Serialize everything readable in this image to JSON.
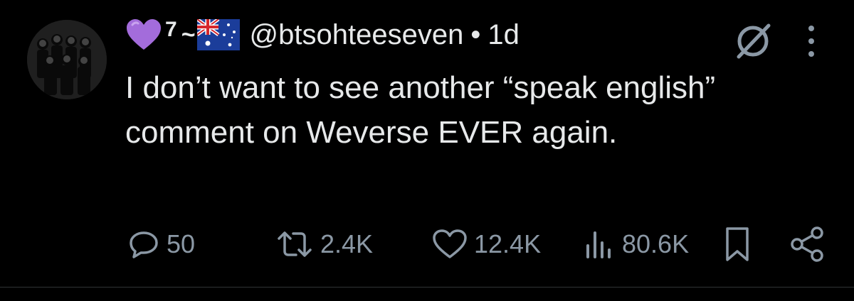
{
  "author": {
    "display_name_number": "7",
    "display_name_tilde": "~",
    "handle": "@btsohteeseven",
    "separator": "•",
    "time": "1d"
  },
  "tweet": {
    "text": "I don’t want to see another “speak english” comment on Weverse EVER again."
  },
  "actions": {
    "replies": "50",
    "reposts": "2.4K",
    "likes": "12.4K",
    "views": "80.6K"
  },
  "icons": {
    "heart": "purple-heart-emoji",
    "flag": "australia-flag-emoji",
    "grok": "grok-icon",
    "more": "more-icon",
    "reply": "reply-icon",
    "repost": "repost-icon",
    "like": "like-icon",
    "views": "views-icon",
    "bookmark": "bookmark-icon",
    "share": "share-icon"
  },
  "colors": {
    "background": "#000000",
    "text": "#e7e9ea",
    "secondary": "#8b98a5",
    "heart": "#a36cdb"
  }
}
